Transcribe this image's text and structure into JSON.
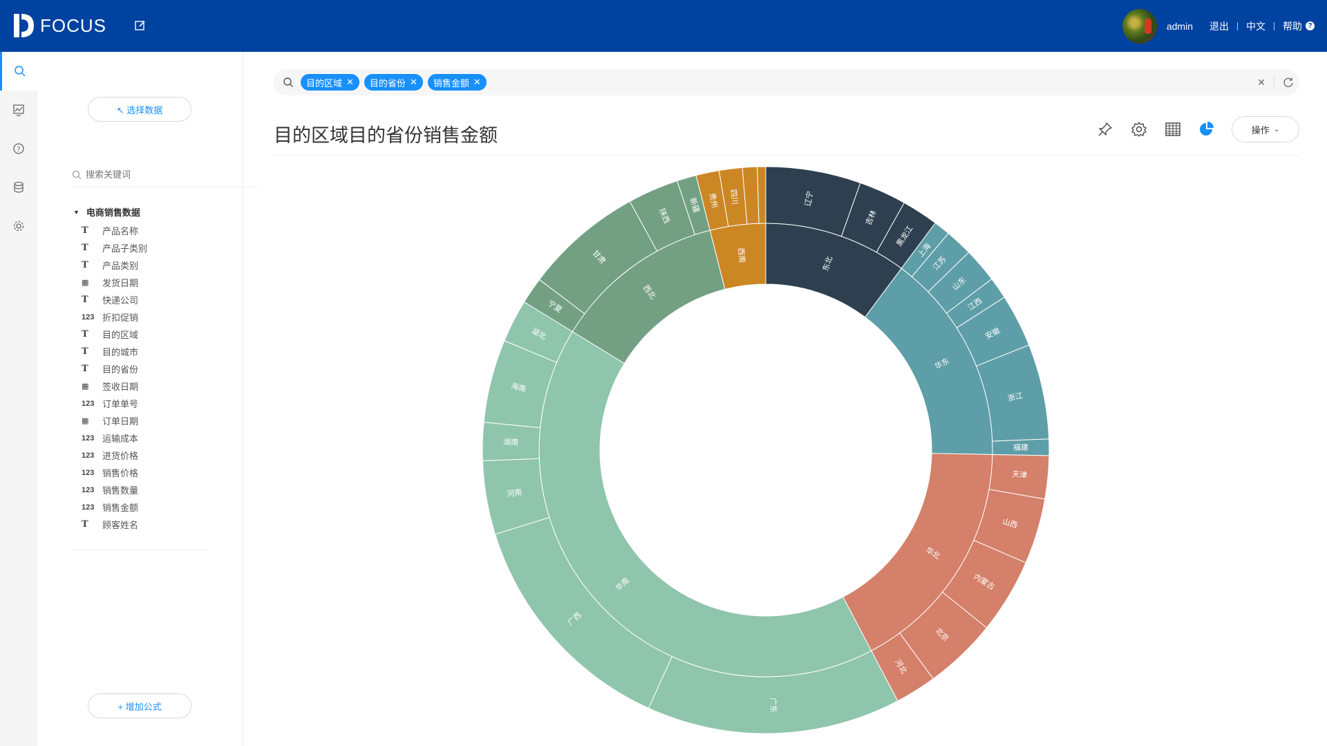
{
  "app": {
    "brand": "FOCUS"
  },
  "header": {
    "username": "admin",
    "logout": "退出",
    "language": "中文",
    "help": "帮助"
  },
  "rail": {
    "items": [
      "search-icon",
      "dashboard-icon",
      "help-icon",
      "database-icon",
      "settings-icon"
    ],
    "active": "search-icon"
  },
  "panel": {
    "select_data": "↖ 选择数据",
    "search_placeholder": "搜索关键词",
    "dataset": "电商销售数据",
    "fields": [
      {
        "type": "text",
        "label": "产品名称"
      },
      {
        "type": "text",
        "label": "产品子类别"
      },
      {
        "type": "text",
        "label": "产品类别"
      },
      {
        "type": "date",
        "label": "发货日期"
      },
      {
        "type": "text",
        "label": "快递公司"
      },
      {
        "type": "number",
        "label": "折扣促销"
      },
      {
        "type": "text",
        "label": "目的区域"
      },
      {
        "type": "text",
        "label": "目的城市"
      },
      {
        "type": "text",
        "label": "目的省份"
      },
      {
        "type": "date",
        "label": "签收日期"
      },
      {
        "type": "number",
        "label": "订单单号"
      },
      {
        "type": "date",
        "label": "订单日期"
      },
      {
        "type": "number",
        "label": "运输成本"
      },
      {
        "type": "number",
        "label": "进货价格"
      },
      {
        "type": "number",
        "label": "销售价格"
      },
      {
        "type": "number",
        "label": "销售数量"
      },
      {
        "type": "number",
        "label": "销售金额"
      },
      {
        "type": "text",
        "label": "顾客姓名"
      }
    ],
    "add_formula": "+ 增加公式"
  },
  "search": {
    "tags": [
      "目的区域",
      "目的省份",
      "销售金额"
    ]
  },
  "chart_title": "目的区域目的省份销售金额",
  "toolbar": {
    "ops_label": "操作"
  },
  "chart_data": {
    "type": "sunburst",
    "title": "目的区域目的省份销售金额",
    "colors": {
      "东北": "#2e4050",
      "华东": "#5e9ea8",
      "华北": "#d4806a",
      "华南": "#8fc5ac",
      "西北": "#73a083",
      "西南": "#cc8725"
    },
    "regions": [
      {
        "name": "东北",
        "value": 9.8,
        "children": [
          {
            "name": "辽宁",
            "value": 5.2
          },
          {
            "name": "吉林",
            "value": 2.6
          },
          {
            "name": "黑龙江",
            "value": 2.0
          }
        ]
      },
      {
        "name": "华东",
        "value": 14.5,
        "children": [
          {
            "name": "上海",
            "value": 0.9
          },
          {
            "name": "江苏",
            "value": 1.5
          },
          {
            "name": "山东",
            "value": 1.9
          },
          {
            "name": "江西",
            "value": 1.2
          },
          {
            "name": "安徽",
            "value": 2.9
          },
          {
            "name": "浙江",
            "value": 5.2
          },
          {
            "name": "福建",
            "value": 0.9
          }
        ]
      },
      {
        "name": "华北",
        "value": 16.3,
        "children": [
          {
            "name": "天津",
            "value": 2.3
          },
          {
            "name": "山西",
            "value": 3.5
          },
          {
            "name": "内蒙古",
            "value": 4.0
          },
          {
            "name": "北京",
            "value": 3.9
          },
          {
            "name": "河北",
            "value": 2.2
          }
        ]
      },
      {
        "name": "华南",
        "value": 39.8,
        "children": [
          {
            "name": "广东",
            "value": 10.7
          },
          {
            "name": "广西",
            "value": 9.9
          },
          {
            "name": "河南",
            "value": 3.1
          },
          {
            "name": "湖南",
            "value": 1.6
          },
          {
            "name": "海南",
            "value": 3.5
          },
          {
            "name": "湖北",
            "value": 1.8
          }
        ]
      },
      {
        "name": "西北",
        "value": 11.8,
        "children": [
          {
            "name": "宁夏",
            "value": 1.1
          },
          {
            "name": "甘肃",
            "value": 4.9
          },
          {
            "name": "陕西",
            "value": 2.1
          },
          {
            "name": "新疆",
            "value": 0.8
          }
        ]
      },
      {
        "name": "西南",
        "value": 3.8,
        "children": [
          {
            "name": "贵州",
            "value": 1.1
          },
          {
            "name": "四川",
            "value": 1.1
          },
          {
            "name": "",
            "value": 0.7
          },
          {
            "name": "",
            "value": 0.4
          }
        ]
      }
    ]
  }
}
